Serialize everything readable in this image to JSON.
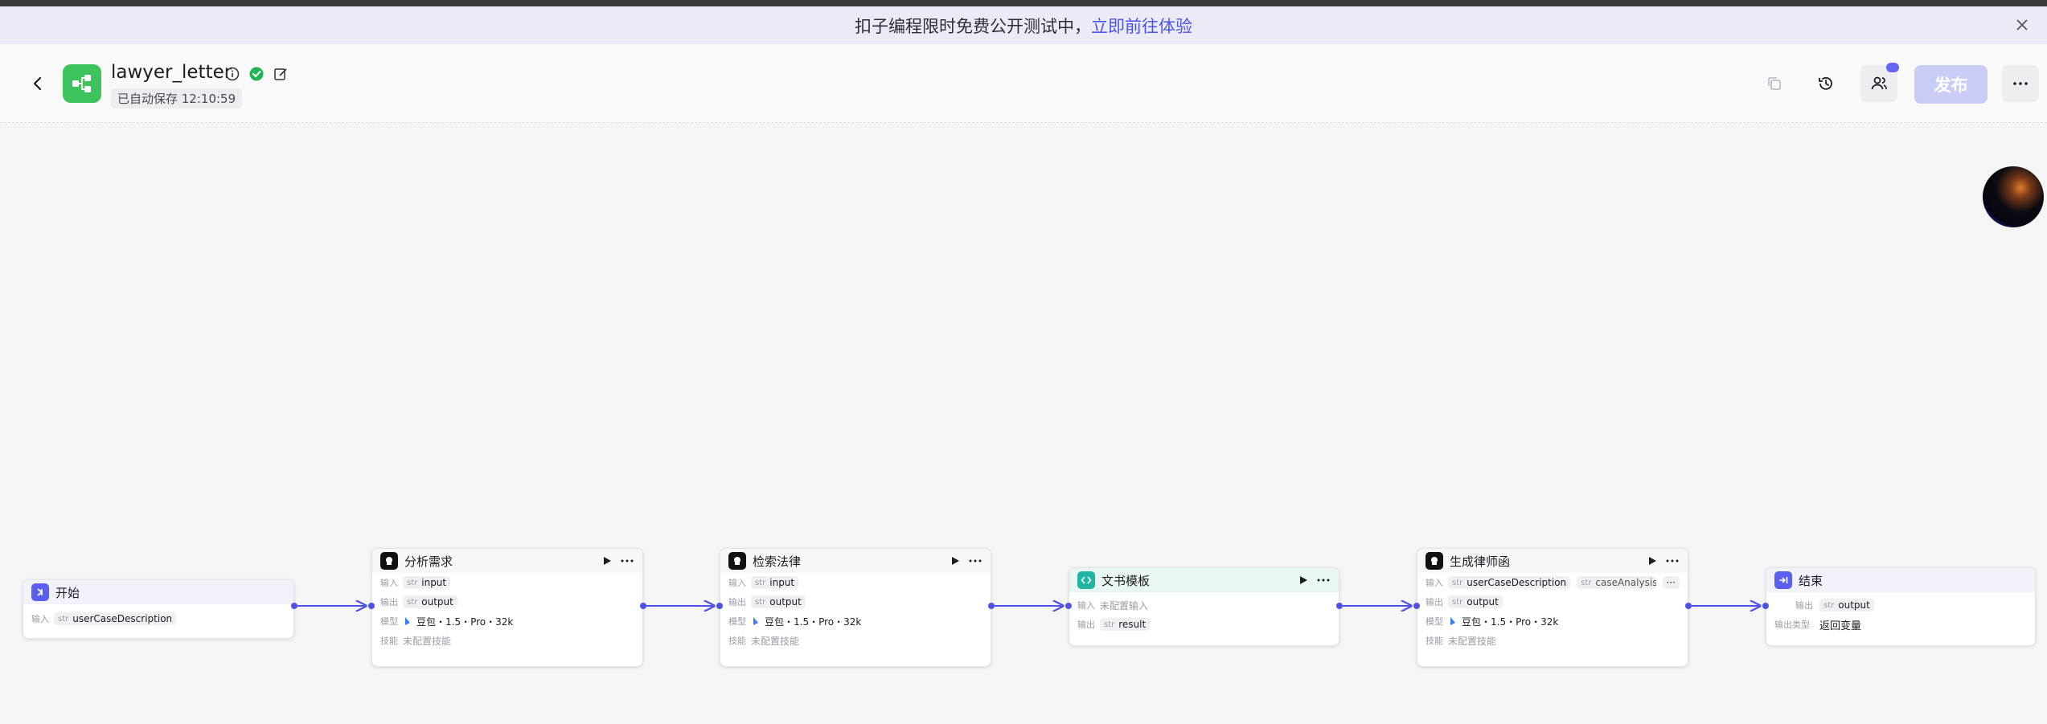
{
  "banner": {
    "text": "扣子编程限时免费公开测试中，",
    "link": "立即前往体验"
  },
  "header": {
    "app_name": "lawyer_letter",
    "autosave": "已自动保存 12:10:59",
    "publish_label": "发布"
  },
  "colors": {
    "accent": "#4d53e8",
    "app_icon": "#3cc35c",
    "publish_disabled": "#c9cdf6"
  },
  "nodes": {
    "start": {
      "title": "开始",
      "in_label": "输入",
      "type": "str",
      "var": "userCaseDescription"
    },
    "analyze": {
      "title": "分析需求",
      "in_label": "输入",
      "in_var": "input",
      "out_label": "输出",
      "out_var": "output",
      "model_label": "模型",
      "model": "豆包・1.5・Pro・32k",
      "skill_label": "技能",
      "skill": "未配置技能",
      "type": "str"
    },
    "search": {
      "title": "检索法律",
      "in_label": "输入",
      "in_var": "input",
      "out_label": "输出",
      "out_var": "output",
      "model_label": "模型",
      "model": "豆包・1.5・Pro・32k",
      "skill_label": "技能",
      "skill": "未配置技能",
      "type": "str"
    },
    "template": {
      "title": "文书模板",
      "in_label": "输入",
      "in_value": "未配置输入",
      "out_label": "输出",
      "out_var": "result",
      "type": "str"
    },
    "generate": {
      "title": "生成律师函",
      "in_label": "输入",
      "in_var1": "userCaseDescription",
      "in_var2": "caseAnalysisAv",
      "more": "···",
      "out_label": "输出",
      "out_var": "output",
      "model_label": "模型",
      "model": "豆包・1.5・Pro・32k",
      "skill_label": "技能",
      "skill": "未配置技能",
      "type": "str"
    },
    "end": {
      "title": "结束",
      "out_label": "输出",
      "out_var": "output",
      "type_label": "输出类型",
      "type_value": "返回变量",
      "type": "str"
    }
  }
}
